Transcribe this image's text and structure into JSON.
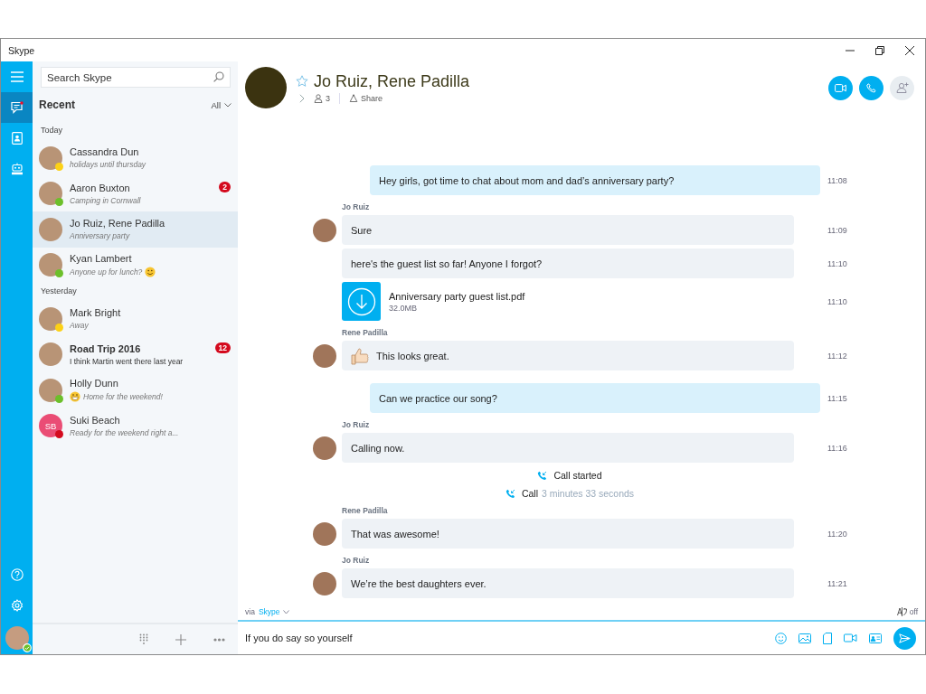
{
  "window": {
    "title": "Skype"
  },
  "search": {
    "placeholder": "Search Skype"
  },
  "recent": {
    "title": "Recent",
    "filter": "All"
  },
  "groups": [
    {
      "label": "Today",
      "contacts": [
        {
          "name": "Cassandra Dun",
          "message": "holidays until thursday",
          "color": "#fcd116",
          "selected": false
        },
        {
          "name": "Aaron Buxton",
          "message": "Camping in Cornwall",
          "color": "#6cbf2a",
          "badge": "2",
          "selected": false
        },
        {
          "name": "Jo Ruiz, Rene Padilla",
          "message": "Anniversary party",
          "selected": true
        },
        {
          "name": "Kyan Lambert",
          "message": "Anyone up for lunch?",
          "color": "#6cbf2a",
          "emoji_after": true,
          "selected": false
        }
      ]
    },
    {
      "label": "Yesterday",
      "contacts": [
        {
          "name": "Mark Bright",
          "message": "Away",
          "color": "#fcd116",
          "selected": false
        },
        {
          "name": "Road Trip 2016",
          "message": "I think Martin went there last year",
          "badge": "12",
          "unread": true,
          "selected": false
        },
        {
          "name": "Holly Dunn",
          "message": "Home for the weekend!",
          "color": "#6cbf2a",
          "emoji_before": true,
          "selected": false
        },
        {
          "name": "Suki Beach",
          "initials": "SB",
          "message": "Ready for the weekend right a...",
          "color": "#d40a1e",
          "selected": false
        }
      ]
    }
  ],
  "conversation": {
    "title": "Jo Ruiz, Rene Padilla",
    "participants": "3",
    "share": "Share"
  },
  "messages": [
    {
      "kind": "outgoing",
      "text": "Hey girls, got time to chat about mom and dad’s anniversary party?",
      "time": "11:08"
    },
    {
      "kind": "incoming",
      "sender": "Jo Ruiz",
      "text": "Sure",
      "time": "11:09"
    },
    {
      "kind": "incoming",
      "text": "here's the guest list so far! Anyone I forgot?",
      "time": "11:10"
    },
    {
      "kind": "file",
      "name": "Anniversary party guest list.pdf",
      "size": "32.0MB",
      "time": "11:10"
    },
    {
      "kind": "incoming",
      "sender": "Rene Padilla",
      "text": "This looks great.",
      "thumbs_up": true,
      "time": "11:12"
    },
    {
      "kind": "outgoing",
      "text": "Can we practice our song?",
      "time": "11:15"
    },
    {
      "kind": "incoming",
      "sender": "Jo Ruiz",
      "text": "Calling now.",
      "time": "11:16"
    },
    {
      "kind": "event",
      "text": "Call started"
    },
    {
      "kind": "event",
      "text": "Call",
      "detail": "3 minutes 33 seconds"
    },
    {
      "kind": "incoming",
      "sender": "Rene Padilla",
      "text": "That was awesome!",
      "time": "11:20"
    },
    {
      "kind": "incoming",
      "sender": "Jo Ruiz",
      "text": "We’re the best daughters ever.",
      "time": "11:21"
    }
  ],
  "composer": {
    "via": "via",
    "service": "Skype",
    "translator": "off",
    "value": "If you do say so yourself"
  }
}
